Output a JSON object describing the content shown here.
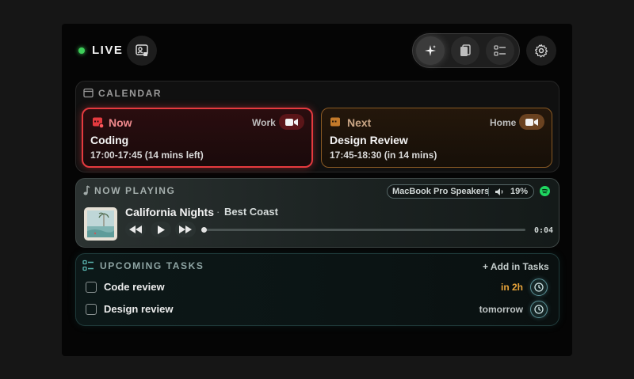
{
  "header": {
    "live_label": "LIVE",
    "colors": {
      "live": "#3ecf5a"
    },
    "icons": [
      "profile-card-icon",
      "sparkle-icon",
      "clipboard-icon",
      "checklist-icon",
      "gear-icon"
    ]
  },
  "calendar": {
    "title": "CALENDAR",
    "now": {
      "status": "Now",
      "tag": "Work",
      "name": "Coding",
      "time": "17:00-17:45 (14 mins left)",
      "color": "#e53a3f"
    },
    "next": {
      "status": "Next",
      "tag": "Home",
      "name": "Design Review",
      "time": "17:45-18:30 (in 14 mins)",
      "color": "#c47a2a"
    }
  },
  "now_playing": {
    "title": "NOW PLAYING",
    "output_device": "MacBook Pro Speakers",
    "volume": "19%",
    "track": "California Nights",
    "separator": "·",
    "artist": "Best Coast",
    "elapsed": "0:04",
    "progress_fraction": 0.0
  },
  "tasks": {
    "title": "UPCOMING TASKS",
    "add_label": "+ Add in Tasks",
    "items": [
      {
        "label": "Code review",
        "due": "in 2h",
        "due_color": "#e8a43a"
      },
      {
        "label": "Design review",
        "due": "tomorrow",
        "due_color": "#bfc5c5"
      }
    ]
  }
}
